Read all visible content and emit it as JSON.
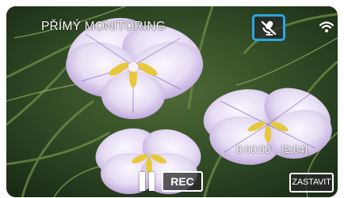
{
  "screen": {
    "title": "PŘÍMÝ MONITORING",
    "accent_color": "#2aa6e6"
  },
  "icons": {
    "mute": "microphone-off-icon",
    "wifi": "wifi-icon",
    "pause": "pause-icon"
  },
  "recording": {
    "elapsed": "0:00:00",
    "remaining": "[2:04]"
  },
  "controls": {
    "rec_label": "REC",
    "stop_label": "ZASTAVIT"
  }
}
